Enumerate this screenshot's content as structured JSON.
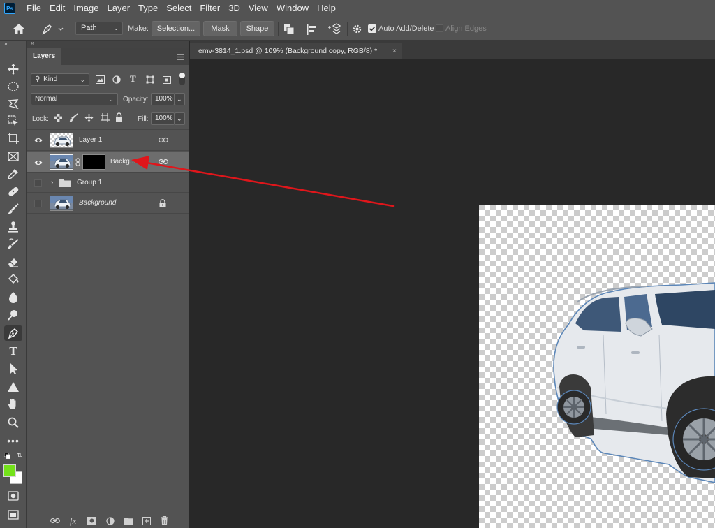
{
  "app": {
    "logo": "Ps",
    "menu": [
      "File",
      "Edit",
      "Image",
      "Layer",
      "Type",
      "Select",
      "Filter",
      "3D",
      "View",
      "Window",
      "Help"
    ]
  },
  "options_bar": {
    "mode_value": "Path",
    "make_label": "Make:",
    "selection_label": "Selection...",
    "mask_label": "Mask",
    "shape_label": "Shape",
    "auto_add_delete_label": "Auto Add/Delete",
    "auto_add_delete_checked": true,
    "align_edges_label": "Align Edges",
    "align_edges_checked": false
  },
  "toolbar": {
    "active_tool": "pen-tool",
    "foreground_color": "#74e21a",
    "background_color": "#ffffff"
  },
  "layers_panel": {
    "tab_label": "Layers",
    "filter_kind": "Kind",
    "blend_mode": "Normal",
    "opacity_label": "Opacity:",
    "opacity_value": "100%",
    "lock_label": "Lock:",
    "fill_label": "Fill:",
    "fill_value": "100%",
    "layers": [
      {
        "name": "Layer 1",
        "visible": true,
        "selected": false
      },
      {
        "name": "Backg...",
        "visible": true,
        "selected": true,
        "has_mask": true
      },
      {
        "name": "Group 1",
        "visible": false,
        "selected": false,
        "is_group": true
      },
      {
        "name": "Background",
        "visible": false,
        "selected": false,
        "locked": true
      }
    ]
  },
  "document": {
    "tab_title": "emv-3814_1.psd @ 109% (Background copy, RGB/8) *",
    "close_symbol": "×"
  },
  "annotation": {
    "arrow_color": "#e0161b"
  }
}
